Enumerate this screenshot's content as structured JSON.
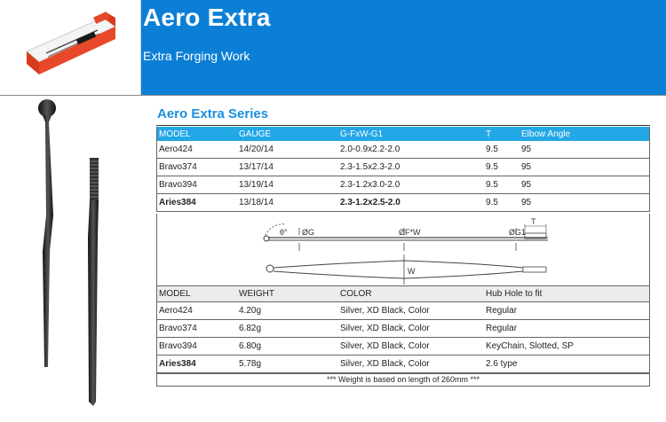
{
  "header": {
    "title": "Aero Extra",
    "subtitle": "Extra Forging Work"
  },
  "series_title": "Aero Extra Series",
  "spec_table": {
    "columns": [
      "MODEL",
      "GAUGE",
      "G-FxW-G1",
      "T",
      "Elbow Angle"
    ],
    "rows": [
      {
        "model": "Aero424",
        "gauge": "14/20/14",
        "gfwg1": "2.0-0.9x2.2-2.0",
        "t": "9.5",
        "elbow": "95"
      },
      {
        "model": "Bravo374",
        "gauge": "13/17/14",
        "gfwg1": "2.3-1.5x2.3-2.0",
        "t": "9.5",
        "elbow": "95"
      },
      {
        "model": "Bravo394",
        "gauge": "13/19/14",
        "gfwg1": "2.3-1.2x3.0-2.0",
        "t": "9.5",
        "elbow": "95"
      },
      {
        "model": "Aries384",
        "gauge": "13/18/14",
        "gfwg1": "2.3-1.2x2.5-2.0",
        "t": "9.5",
        "elbow": "95"
      }
    ]
  },
  "diagram": {
    "labels": {
      "theta": "θ°",
      "g": "ØG",
      "fw": "ØF*W",
      "g1": "ØG1",
      "t": "T",
      "w": "W"
    }
  },
  "weight_table": {
    "columns": [
      "MODEL",
      "WEIGHT",
      "COLOR",
      "Hub Hole to fit"
    ],
    "rows": [
      {
        "model": "Aero424",
        "weight": "4.20g",
        "color": "Silver, XD Black, Color",
        "hub": "Regular"
      },
      {
        "model": "Bravo374",
        "weight": "6.82g",
        "color": "Silver, XD Black, Color",
        "hub": "Regular"
      },
      {
        "model": "Bravo394",
        "weight": "6.80g",
        "color": "Silver, XD Black, Color",
        "hub": "KeyChain, Slotted, SP"
      },
      {
        "model": "Aries384",
        "weight": "5.78g",
        "color": "Silver, XD Black, Color",
        "hub": "2.6 type"
      }
    ],
    "note": "*** Weight is based on length of 260mm ***"
  },
  "colors": {
    "brand_blue": "#0b7fd6",
    "header_row_blue": "#23a7e6",
    "series_title_blue": "#1c8fdc"
  }
}
